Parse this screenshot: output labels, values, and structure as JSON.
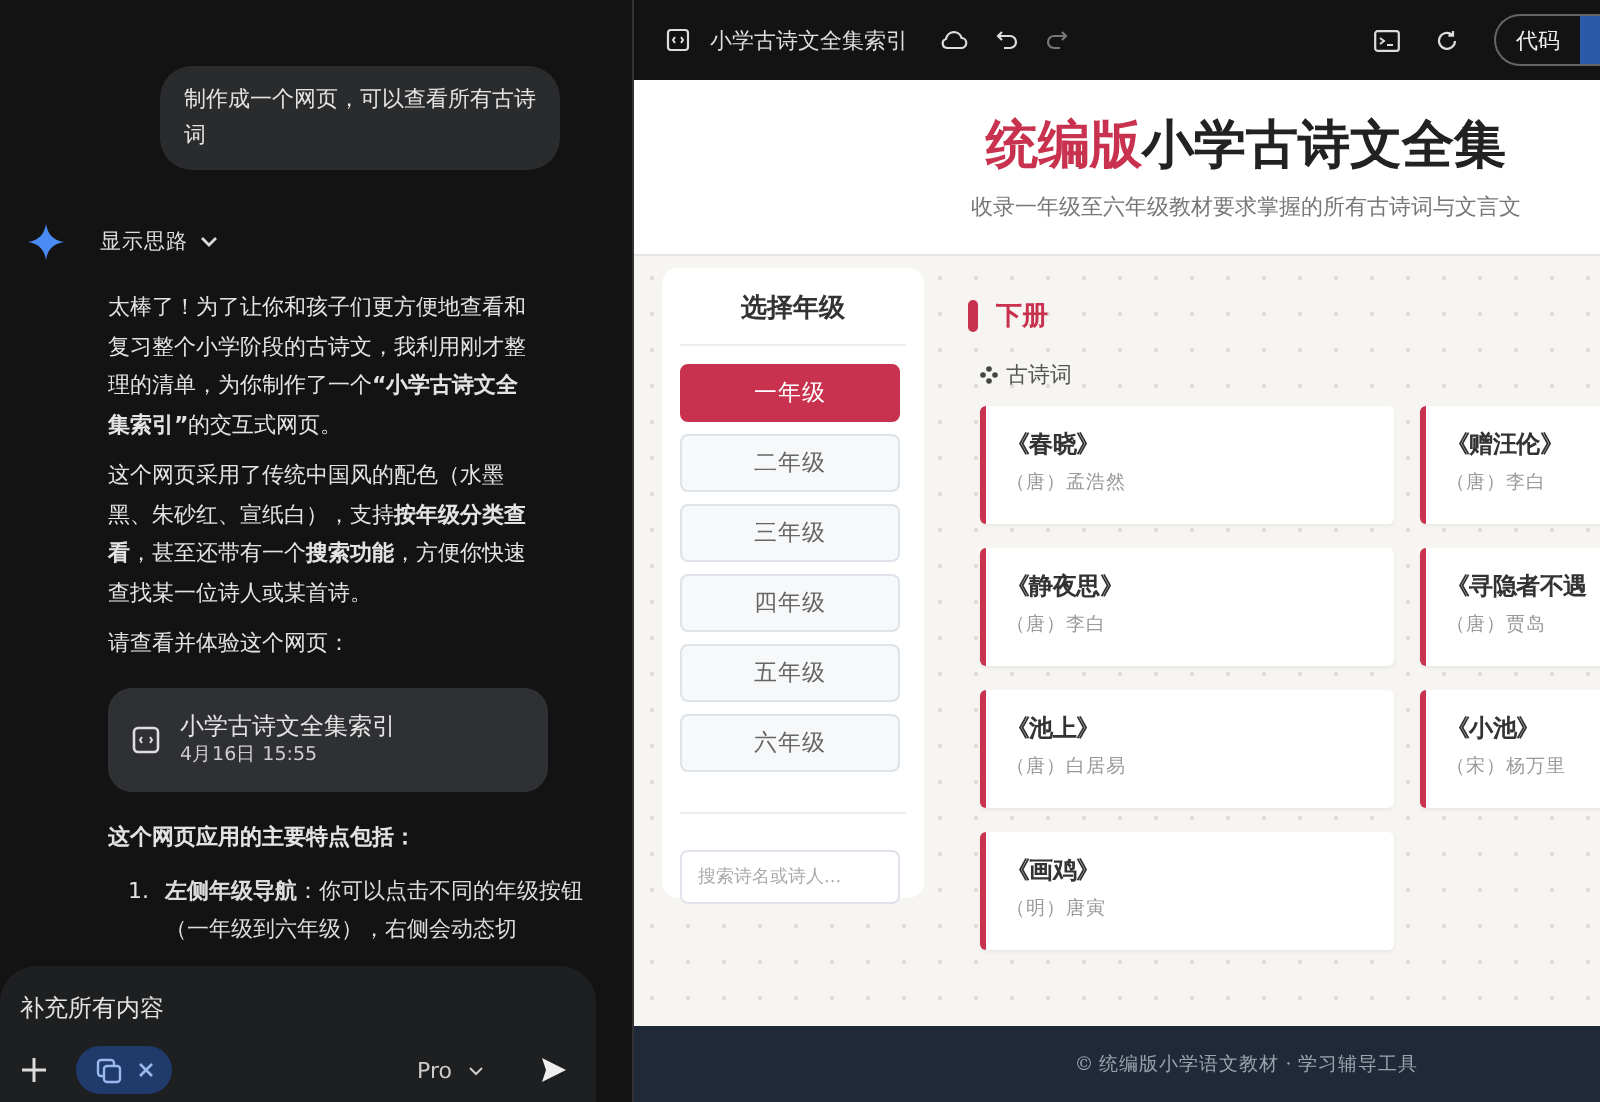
{
  "chat": {
    "user_message": "制作成一个网页，可以查看所有古诗词",
    "thinking_toggle": "显示思路",
    "paragraphs": [
      "太棒了！为了让你和孩子们更方便地查看和复习整个小学阶段的古诗文，我利用刚才整理的清单，为你制作了一个**“小学古诗文全集索引”**的交互式网页。",
      "这个网页采用了传统中国风的配色（水墨黑、朱砂红、宣纸白），支持**按年级分类查看**，甚至还带有一个**搜索功能**，方便你快速查找某一位诗人或某首诗。",
      "请查看并体验这个网页："
    ],
    "artifact": {
      "title": "小学古诗文全集索引",
      "time": "4月16日 15:55"
    },
    "features_heading": "这个网页应用的主要特点包括：",
    "features": [
      {
        "number": "1.",
        "text": "**左侧年级导航**：你可以点击不同的年级按钮（一年级到六年级），右侧会动态切"
      }
    ],
    "composer": {
      "value": "补充所有内容",
      "model": "Pro"
    }
  },
  "preview": {
    "toolbar": {
      "title": "小学古诗文全集索引",
      "mode_tabs": [
        {
          "label": "代码",
          "selected": false
        },
        {
          "selected": true
        }
      ]
    },
    "page": {
      "title_accent": "统编版",
      "title": "小学古诗文全集",
      "subtitle": "收录一年级至六年级教材要求掌握的所有古诗词与文言文",
      "sidebar": {
        "heading": "选择年级",
        "grades": [
          {
            "label": "一年级",
            "selected": true
          },
          {
            "label": "二年级",
            "selected": false
          },
          {
            "label": "三年级",
            "selected": false
          },
          {
            "label": "四年级",
            "selected": false
          },
          {
            "label": "五年级",
            "selected": false
          },
          {
            "label": "六年级",
            "selected": false
          }
        ],
        "search": {
          "placeholder": "搜索诗名或诗人..."
        }
      },
      "section": "下册",
      "category": "古诗词",
      "poems": [
        {
          "title": "《春晓》",
          "author": "（唐）孟浩然"
        },
        {
          "title": "《赠汪伦》",
          "author": "（唐）李白"
        },
        {
          "title": "《静夜思》",
          "author": "（唐）李白"
        },
        {
          "title": "《寻隐者不遇",
          "author": "（唐）贾岛"
        },
        {
          "title": "《池上》",
          "author": "（唐）白居易"
        },
        {
          "title": "《小池》",
          "author": "（宋）杨万里"
        },
        {
          "title": "《画鸡》",
          "author": "（明）唐寅"
        }
      ],
      "footer": "© 统编版小学语文教材 · 学习辅导工具"
    }
  }
}
